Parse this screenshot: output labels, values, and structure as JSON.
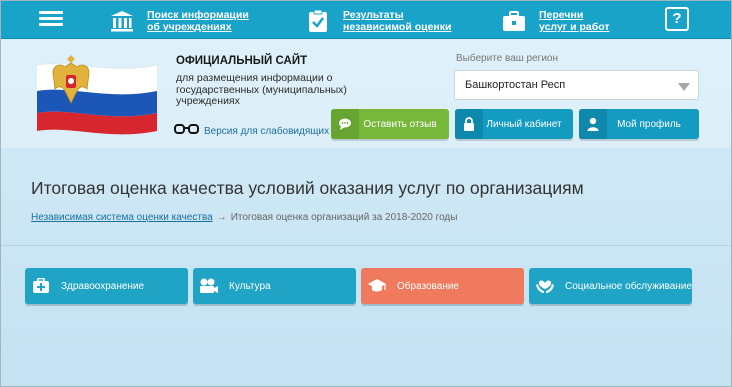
{
  "nav": {
    "links": [
      {
        "label_line1": "Поиск информации",
        "label_line2": "об учреждениях",
        "icon": "building-icon"
      },
      {
        "label_line1": "Результаты",
        "label_line2": "независимой оценки",
        "icon": "clipboard-check-icon"
      },
      {
        "label_line1": "Перечни",
        "label_line2": "услуг и работ",
        "icon": "briefcase-icon"
      }
    ],
    "help_label": "?"
  },
  "header": {
    "site_title": "ОФИЦИАЛЬНЫЙ САЙТ",
    "site_subtitle": "для размещения информации о государственных (муниципальных) учреждениях",
    "low_vision_label": "Версия для слабовидящих",
    "region_label": "Выберите ваш регион",
    "region_value": "Башкортостан Респ",
    "buttons": {
      "review": "Оставить отзыв",
      "cabinet": "Личный кабинет",
      "profile": "Мой профиль"
    }
  },
  "main": {
    "page_title": "Итоговая оценка качества условий оказания услуг по организациям",
    "breadcrumb": {
      "link": "Независимая система оценки качества",
      "separator": "→",
      "current": "Итоговая оценка организаций за 2018-2020 годы"
    },
    "categories": [
      {
        "label": "Здравоохранение",
        "icon": "medical-kit-icon",
        "color": "#1fa4c6"
      },
      {
        "label": "Культура",
        "icon": "film-camera-icon",
        "color": "#1fa4c6"
      },
      {
        "label": "Образование",
        "icon": "graduation-cap-icon",
        "color": "#ef7a5d"
      },
      {
        "label": "Социальное обслуживание",
        "icon": "helping-hands-icon",
        "color": "#1fa4c6"
      }
    ]
  },
  "colors": {
    "nav_bg": "#1aa3c8",
    "accent_blue": "#149bc1",
    "accent_green": "#77b83b",
    "accent_orange": "#ef7a5d"
  }
}
